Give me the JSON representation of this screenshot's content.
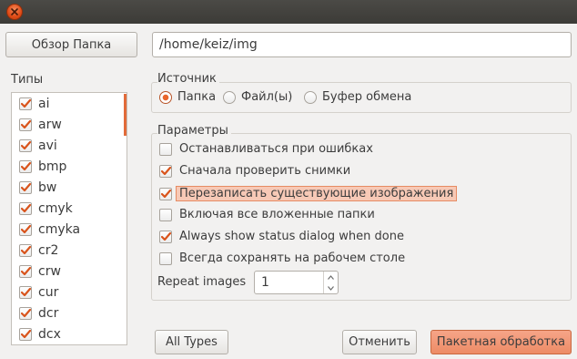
{
  "toolbar": {
    "browse_label": "Обзор Папка",
    "path_value": "/home/keiz/img"
  },
  "types": {
    "title": "Типы",
    "items": [
      {
        "label": "ai",
        "checked": true
      },
      {
        "label": "arw",
        "checked": true
      },
      {
        "label": "avi",
        "checked": true
      },
      {
        "label": "bmp",
        "checked": true
      },
      {
        "label": "bw",
        "checked": true
      },
      {
        "label": "cmyk",
        "checked": true
      },
      {
        "label": "cmyka",
        "checked": true
      },
      {
        "label": "cr2",
        "checked": true
      },
      {
        "label": "crw",
        "checked": true
      },
      {
        "label": "cur",
        "checked": true
      },
      {
        "label": "dcr",
        "checked": true
      },
      {
        "label": "dcx",
        "checked": true
      }
    ]
  },
  "source": {
    "title": "Источник",
    "options": [
      {
        "label": "Папка",
        "selected": true
      },
      {
        "label": "Файл(ы)",
        "selected": false
      },
      {
        "label": "Буфер обмена",
        "selected": false
      }
    ]
  },
  "params": {
    "title": "Параметры",
    "options": [
      {
        "label": "Останавливаться при ошибках",
        "checked": false
      },
      {
        "label": "Сначала проверить снимки",
        "checked": true
      },
      {
        "label": "Перезаписать существующие изображения",
        "checked": true,
        "focused": true
      },
      {
        "label": "Включая все вложенные папки",
        "checked": false
      },
      {
        "label": "Always show status dialog when done",
        "checked": true
      },
      {
        "label": "Всегда сохранять на рабочем столе",
        "checked": false
      }
    ],
    "repeat_label": "Repeat images",
    "repeat_value": "1"
  },
  "footer": {
    "all_types_label": "All Types",
    "cancel_label": "Отменить",
    "batch_label": "Пакетная обработка"
  },
  "colors": {
    "accent": "#e9662c",
    "titlebar": "#3c3b37",
    "window_bg": "#f2f1f0",
    "primary_button": "#ed8c66"
  },
  "icons": {
    "close": "close-icon",
    "check": "check-icon",
    "spin_up": "chevron-up-icon",
    "spin_down": "chevron-down-icon"
  }
}
